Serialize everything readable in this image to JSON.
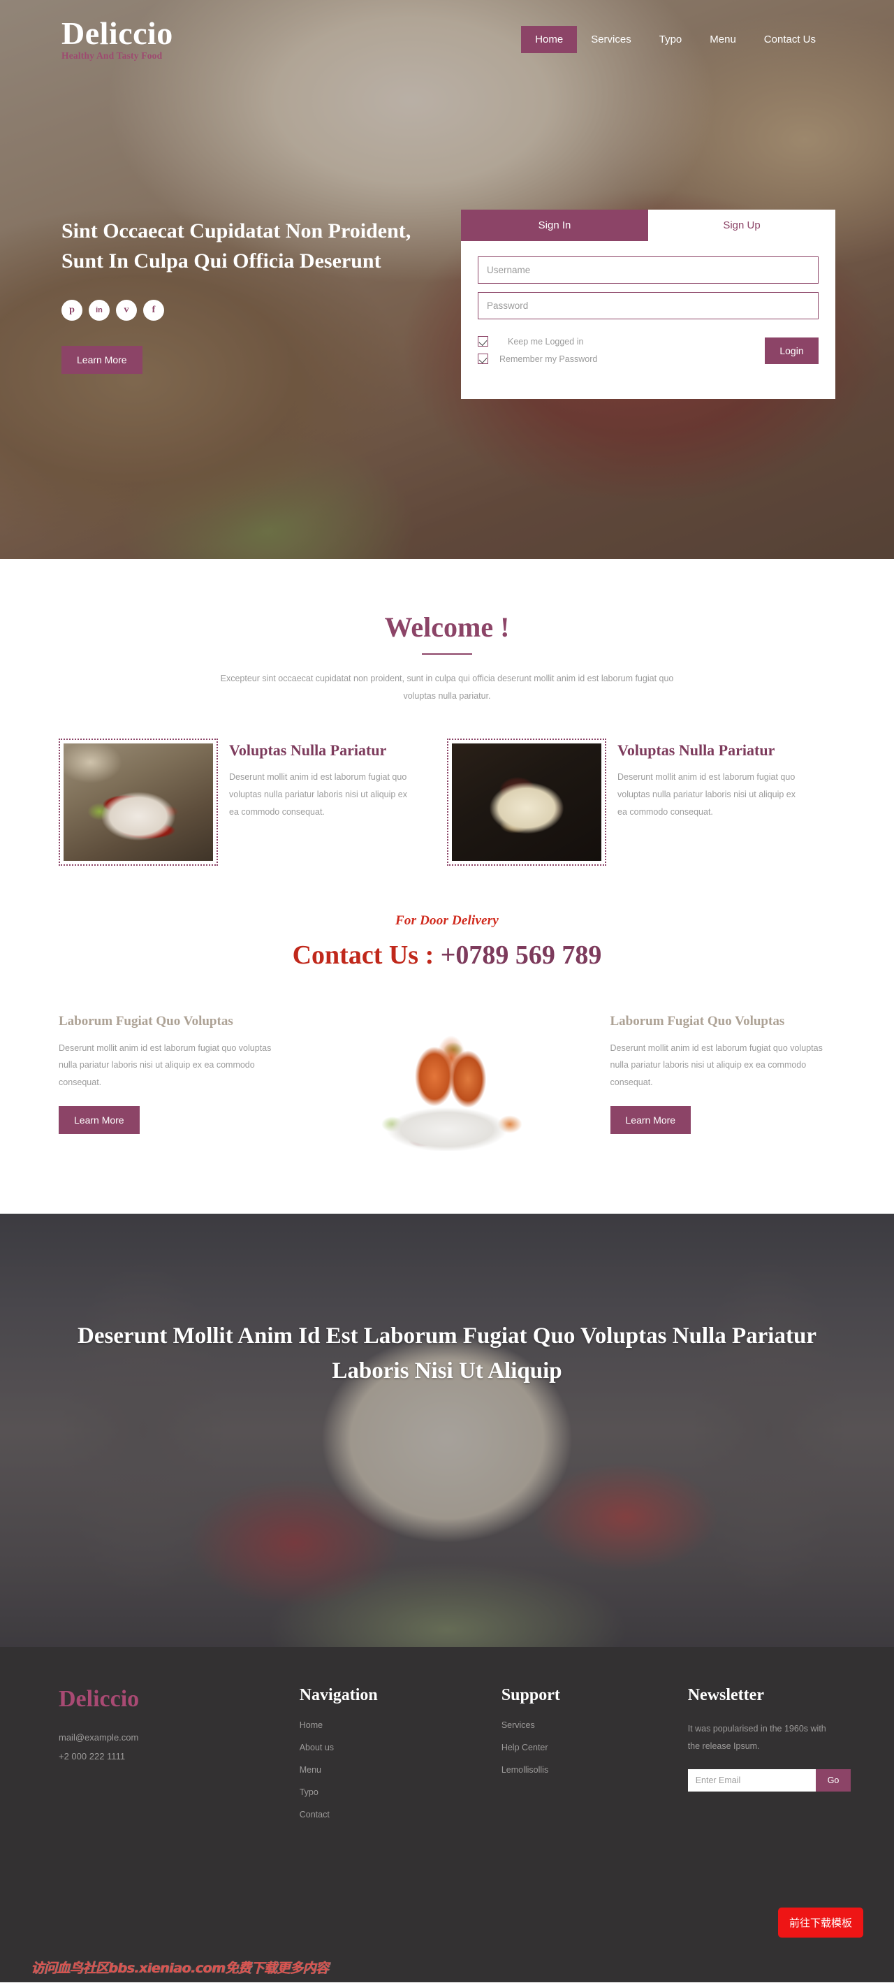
{
  "brand": {
    "name": "Deliccio",
    "tagline": "Healthy And Tasty Food"
  },
  "nav": {
    "items": [
      {
        "label": "Home",
        "active": true
      },
      {
        "label": "Services",
        "active": false
      },
      {
        "label": "Typo",
        "active": false
      },
      {
        "label": "Menu",
        "active": false
      },
      {
        "label": "Contact Us",
        "active": false
      }
    ]
  },
  "hero": {
    "title": "Sint Occaecat Cupidatat Non Proident, Sunt In Culpa Qui Officia Deserunt",
    "cta": "Learn More",
    "socials": [
      {
        "name": "pinterest-icon",
        "glyph": "p"
      },
      {
        "name": "linkedin-icon",
        "glyph": "in"
      },
      {
        "name": "vimeo-icon",
        "glyph": "v"
      },
      {
        "name": "facebook-icon",
        "glyph": "f"
      }
    ]
  },
  "auth": {
    "tab_signin": "Sign In",
    "tab_signup": "Sign Up",
    "username_value": "",
    "username_placeholder": "Username",
    "password_value": "",
    "password_placeholder": "Password",
    "keep_logged_label": "Keep me Logged in",
    "remember_label": "Remember my Password",
    "login_button": "Login"
  },
  "welcome": {
    "heading": "Welcome !",
    "paragraph": "Excepteur sint occaecat cupidatat non proident, sunt in culpa qui officia deserunt mollit anim id est laborum fugiat quo voluptas nulla pariatur."
  },
  "features": [
    {
      "title": "Voluptas Nulla Pariatur",
      "text": "Deserunt mollit anim id est laborum fugiat quo voluptas nulla pariatur laboris nisi ut aliquip ex ea commodo consequat.",
      "image_name": "crawfish-plate-photo"
    },
    {
      "title": "Voluptas Nulla Pariatur",
      "text": "Deserunt mollit anim id est laborum fugiat quo voluptas nulla pariatur laboris nisi ut aliquip ex ea commodo consequat.",
      "image_name": "pasta-plate-photo"
    }
  ],
  "delivery": {
    "eyebrow": "For Door Delivery",
    "contact_label": "Contact Us : ",
    "phone": "+0789 569 789"
  },
  "trio": {
    "left": {
      "title": "Laborum Fugiat Quo Voluptas",
      "text": "Deserunt mollit anim id est laborum fugiat quo voluptas nulla pariatur laboris nisi ut aliquip ex ea commodo consequat.",
      "cta": "Learn More"
    },
    "middle_image_name": "shrimp-platter-photo",
    "right": {
      "title": "Laborum Fugiat Quo Voluptas",
      "text": "Deserunt mollit anim id est laborum fugiat quo voluptas nulla pariatur laboris nisi ut aliquip ex ea commodo consequat.",
      "cta": "Learn More"
    }
  },
  "banner": {
    "text": "Deserunt Mollit Anim Id Est Laborum Fugiat Quo Voluptas Nulla Pariatur Laboris Nisi Ut Aliquip"
  },
  "footer": {
    "logo": "Deliccio",
    "email": "mail@example.com",
    "phone": "+2 000 222 1111",
    "nav_heading": "Navigation",
    "nav_links": [
      {
        "label": "Home"
      },
      {
        "label": "About us"
      },
      {
        "label": "Menu"
      },
      {
        "label": "Typo"
      },
      {
        "label": "Contact"
      }
    ],
    "support_heading": "Support",
    "support_links": [
      {
        "label": "Services"
      },
      {
        "label": "Help Center"
      },
      {
        "label": "Lemollisollis"
      }
    ],
    "newsletter_heading": "Newsletter",
    "newsletter_text": "It was popularised in the 1960s with the release Ipsum.",
    "email_value": "",
    "email_placeholder": "Enter Email",
    "go_button": "Go",
    "download_button": "前往下载模板",
    "watermark": "访问血鸟社区bbs.xieniao.com免费下载更多内容"
  },
  "colors": {
    "accent_plum": "#8c4467",
    "accent_plum_dark": "#7d3b5c",
    "brand_pink": "#a94a73",
    "delivery_red": "#c0281b",
    "download_red": "#ee1515",
    "footer_bg": "#333132",
    "muted_text": "#9b9b9b",
    "heading_taupe": "#ada295"
  }
}
